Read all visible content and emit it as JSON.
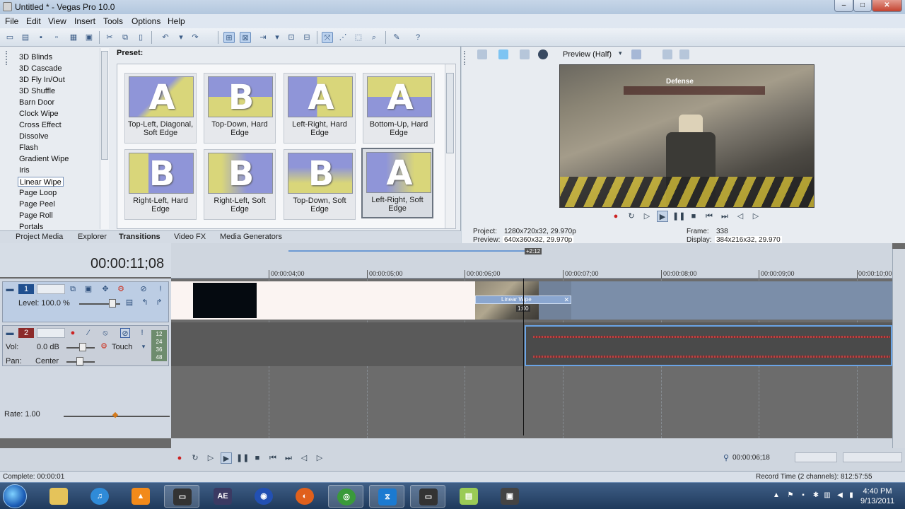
{
  "window": {
    "title": "Untitled * - Vegas Pro 10.0",
    "min": "–",
    "max": "□",
    "close": "✕"
  },
  "menu": [
    "File",
    "Edit",
    "View",
    "Insert",
    "Tools",
    "Options",
    "Help"
  ],
  "transitions": {
    "list": [
      "3D Blinds",
      "3D Cascade",
      "3D Fly In/Out",
      "3D Shuffle",
      "Barn Door",
      "Clock Wipe",
      "Cross Effect",
      "Dissolve",
      "Flash",
      "Gradient Wipe",
      "Iris",
      "Linear Wipe",
      "Page Loop",
      "Page Peel",
      "Page Roll",
      "Portals"
    ],
    "selected": "Linear Wipe",
    "preset_label": "Preset:",
    "presets": [
      {
        "label": "Top-Left, Diagonal, Soft Edge",
        "letter": "A"
      },
      {
        "label": "Top-Down, Hard Edge",
        "letter": "B"
      },
      {
        "label": "Left-Right, Hard Edge",
        "letter": "A"
      },
      {
        "label": "Bottom-Up, Hard Edge",
        "letter": "A"
      },
      {
        "label": "Right-Left, Hard Edge",
        "letter": "B"
      },
      {
        "label": "Right-Left, Soft Edge",
        "letter": "B"
      },
      {
        "label": "Top-Down, Soft Edge",
        "letter": "B"
      },
      {
        "label": "Left-Right, Soft Edge",
        "letter": "A"
      }
    ],
    "selected_preset": "Left-Right, Soft Edge"
  },
  "tabs": {
    "items": [
      "Project Media",
      "Explorer",
      "Transitions",
      "Video FX",
      "Media Generators"
    ],
    "active": "Transitions"
  },
  "preview": {
    "mode": "Preview (Half)",
    "hud_text": "Defense",
    "project_label": "Project:",
    "project_value": "1280x720x32, 29.970p",
    "preview_label": "Preview:",
    "preview_value": "640x360x32, 29.970p",
    "frame_label": "Frame:",
    "frame_value": "338",
    "display_label": "Display:",
    "display_value": "384x216x32, 29.970"
  },
  "timeline": {
    "timecode": "00:00:11;08",
    "ruler": [
      "00:00:04;00",
      "00:00:05;00",
      "00:00:06;00",
      "00:00:07;00",
      "00:00:08;00",
      "00:00:09;00",
      "00:00:10;00"
    ],
    "loop_marker": "+2:12",
    "video_track": {
      "number": "1",
      "level_label": "Level: 100.0 %"
    },
    "audio_track": {
      "number": "2",
      "vol_label": "Vol:",
      "vol_value": "0.0 dB",
      "mode": "Touch",
      "pan_label": "Pan:",
      "pan_value": "Center",
      "meter": [
        "12",
        "24",
        "36",
        "48"
      ]
    },
    "transition_clip": {
      "label": "Linear Wipe",
      "duration": "1:00"
    },
    "rate": "Rate: 1.00",
    "cursor_time": "00:00:06;18"
  },
  "status": {
    "left": "Complete: 00:00:01",
    "right": "Record Time (2 channels): 812:57:55"
  },
  "taskbar": {
    "apps": [
      "explorer",
      "itunes",
      "vlc",
      "vegas",
      "after-effects",
      "globe",
      "firefox",
      "chrome",
      "vegas-alt",
      "vegas-2",
      "notepad",
      "scanner"
    ],
    "ae_label": "AE",
    "time": "4:40 PM",
    "date": "9/13/2011"
  },
  "colors": {
    "accent": "#3a6ea5",
    "selection": "#6aa4e6",
    "video_track": "#1f4f8f",
    "audio_track": "#8c2a2a"
  }
}
